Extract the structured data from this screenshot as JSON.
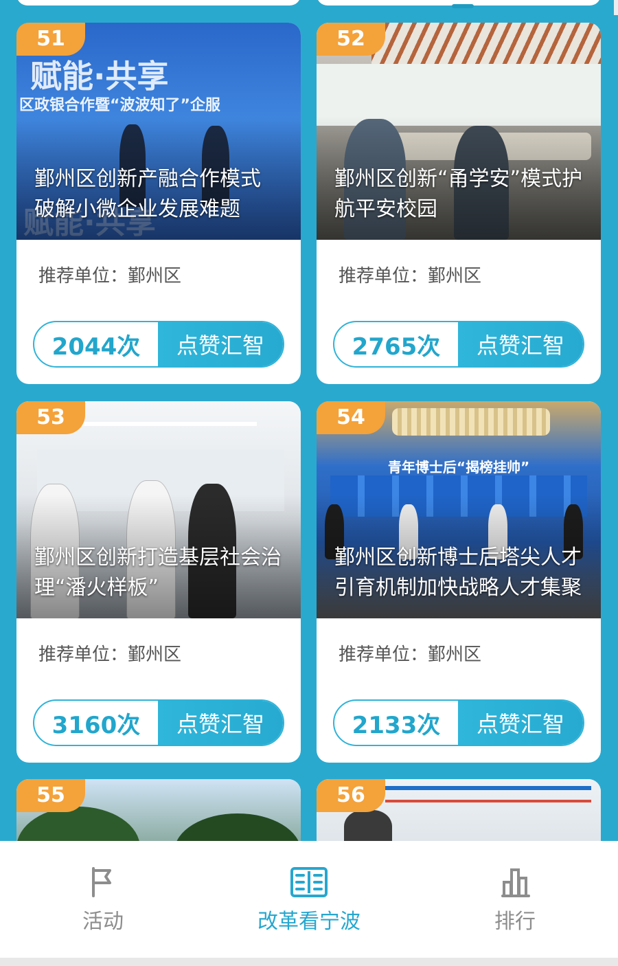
{
  "cards": [
    {
      "number": "51",
      "title": "鄞州区创新产融合作模式 破解小微企业发展难题",
      "org": "推荐单位：鄞州区",
      "likes": "2044次",
      "like_label": "点赞汇智",
      "banner_text_1": "赋能·共享",
      "banner_text_2": "区政银合作暨“波波知了”企服"
    },
    {
      "number": "52",
      "title": "鄞州区创新“甬学安”模式护航平安校园",
      "org": "推荐单位：鄞州区",
      "likes": "2765次",
      "like_label": "点赞汇智"
    },
    {
      "number": "53",
      "title": "鄞州区创新打造基层社会治理“潘火样板”",
      "org": "推荐单位：鄞州区",
      "likes": "3160次",
      "like_label": "点赞汇智"
    },
    {
      "number": "54",
      "title": "鄞州区创新博士后塔尖人才引育机制加快战略人才集聚",
      "org": "推荐单位：鄞州区",
      "likes": "2133次",
      "like_label": "点赞汇智",
      "banner_text_1": "青年博士后“揭榜挂帅”"
    },
    {
      "number": "55"
    },
    {
      "number": "56"
    }
  ],
  "tabbar": {
    "items": [
      {
        "label": "活动",
        "icon": "flag-icon",
        "active": false
      },
      {
        "label": "改革看宁波",
        "icon": "list-card-icon",
        "active": true
      },
      {
        "label": "排行",
        "icon": "bar-chart-icon",
        "active": false
      }
    ]
  },
  "colors": {
    "page_background": "#2aa9cf",
    "badge": "#f4a23a",
    "accent": "#27a7cf",
    "inactive_tab": "#8d8d8d"
  }
}
